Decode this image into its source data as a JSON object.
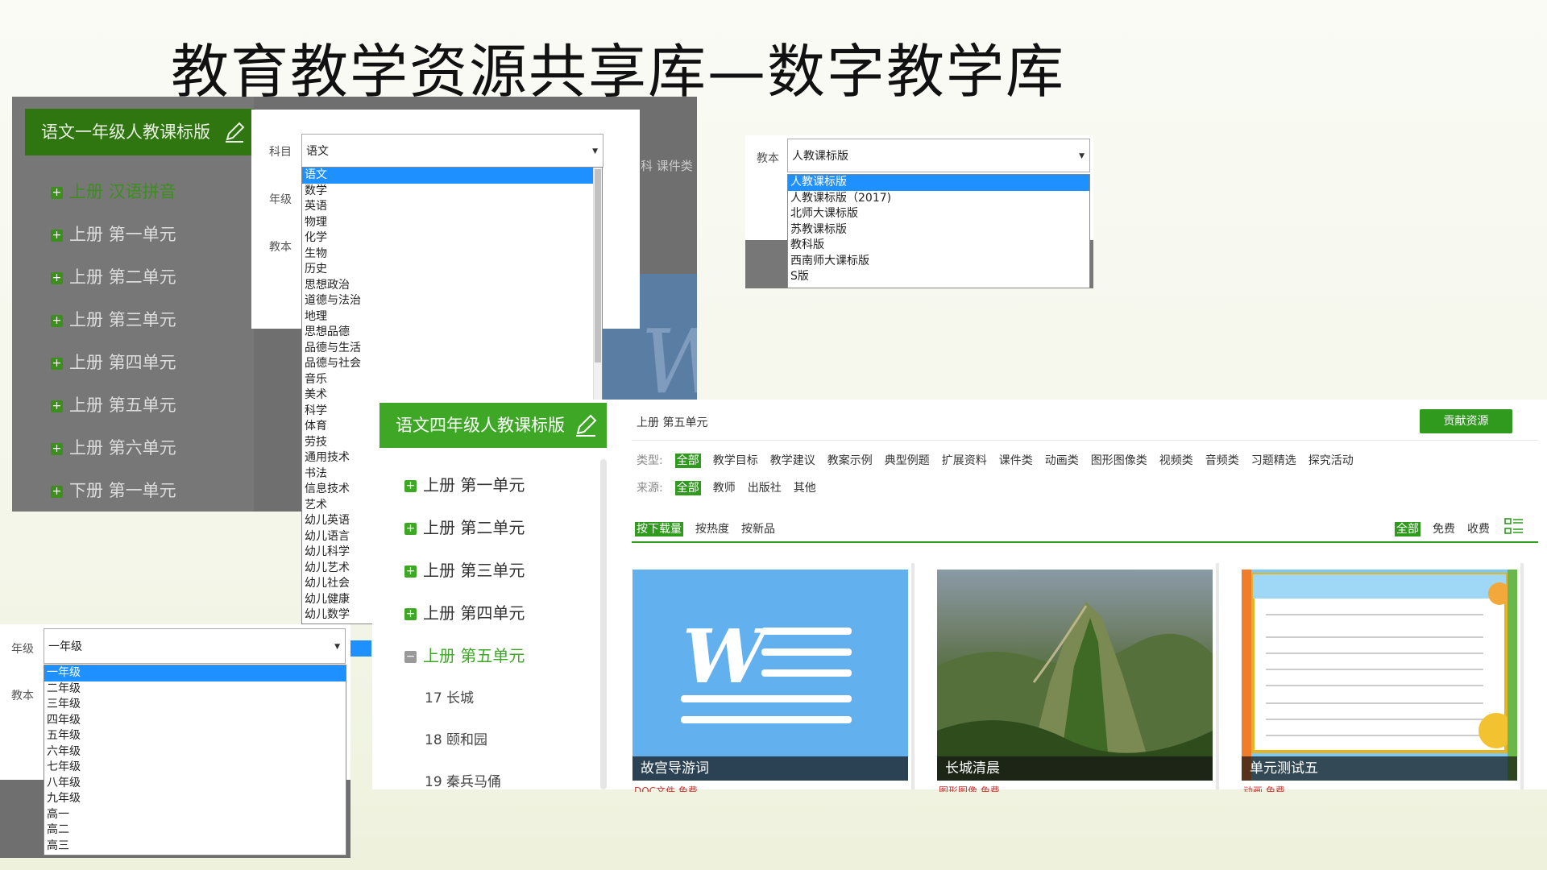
{
  "title": "教育教学资源共享库—数字教学库",
  "panel1": {
    "header": "语文一年级人教课标版",
    "items": [
      "上册 汉语拼音",
      "上册 第一单元",
      "上册 第二单元",
      "上册 第三单元",
      "上册 第四单元",
      "上册 第五单元",
      "上册 第六单元",
      "下册 第一单元"
    ],
    "right_label": "科  课件类"
  },
  "form": {
    "subject_label": "科目",
    "grade_label": "年级",
    "textbook_label": "教本",
    "subject_value": "语文",
    "subjects": [
      "语文",
      "数学",
      "英语",
      "物理",
      "化学",
      "生物",
      "历史",
      "思想政治",
      "道德与法治",
      "地理",
      "思想品德",
      "品德与生活",
      "品德与社会",
      "音乐",
      "美术",
      "科学",
      "体育",
      "劳技",
      "通用技术",
      "书法",
      "信息技术",
      "艺术",
      "幼儿英语",
      "幼儿语言",
      "幼儿科学",
      "幼儿艺术",
      "幼儿社会",
      "幼儿健康",
      "幼儿数学"
    ]
  },
  "textbook_select": {
    "label": "教本",
    "value": "人教课标版",
    "options": [
      "人教课标版",
      "人教课标版（2017)",
      "北师大课标版",
      "苏教课标版",
      "教科版",
      "西南师大课标版",
      "S版"
    ]
  },
  "grade_select": {
    "label": "年级",
    "textbook_label": "教本",
    "value": "一年级",
    "options": [
      "一年级",
      "二年级",
      "三年级",
      "四年级",
      "五年级",
      "六年级",
      "七年级",
      "八年级",
      "九年级",
      "高一",
      "高二",
      "高三"
    ]
  },
  "main": {
    "header": "语文四年级人教课标版",
    "units": [
      {
        "label": "上册 第一单元",
        "active": false
      },
      {
        "label": "上册 第二单元",
        "active": false
      },
      {
        "label": "上册 第三单元",
        "active": false
      },
      {
        "label": "上册 第四单元",
        "active": false
      },
      {
        "label": "上册 第五单元",
        "active": true
      }
    ],
    "lessons": [
      "17 长城",
      "18 颐和园",
      "19 秦兵马俑"
    ],
    "breadcrumb": "上册 第五单元",
    "contribute": "贡献资源",
    "type_label": "类型:",
    "types": [
      "全部",
      "教学目标",
      "教学建议",
      "教案示例",
      "典型例题",
      "扩展资料",
      "课件类",
      "动画类",
      "图形图像类",
      "视频类",
      "音频类",
      "习题精选",
      "探究活动"
    ],
    "source_label": "来源:",
    "sources": [
      "全部",
      "教师",
      "出版社",
      "其他"
    ],
    "sort": [
      "按下载量",
      "按热度",
      "按新品"
    ],
    "price": [
      "全部",
      "免费",
      "收费"
    ],
    "cards": [
      {
        "caption": "故宫导游词",
        "meta": "DOC文件  免费"
      },
      {
        "caption": "长城清晨",
        "meta": "图形图像  免费"
      },
      {
        "caption": "单元测试五",
        "meta": "动画  免费"
      }
    ]
  },
  "colors": {
    "green": "#3ea826",
    "dark_green": "#2f7510",
    "select_blue": "#1e90ff"
  }
}
